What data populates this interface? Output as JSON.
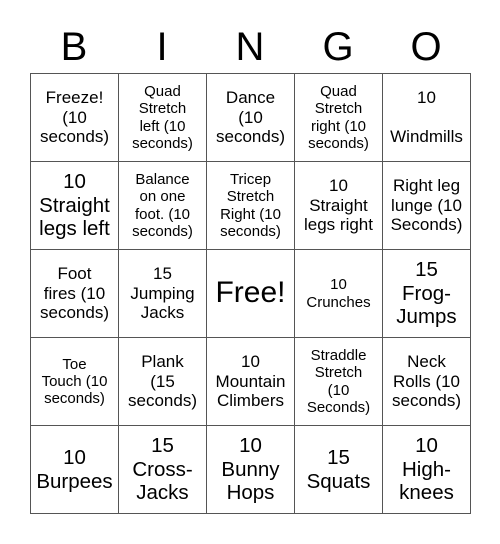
{
  "header": [
    "B",
    "I",
    "N",
    "G",
    "O"
  ],
  "cells": [
    "Freeze!\n(10\nseconds)",
    "Quad\nStretch\nleft (10\nseconds)",
    "Dance\n(10\nseconds)",
    "Quad\nStretch\nright (10\nseconds)",
    "10\n\nWindmills",
    "10\nStraight\nlegs left",
    "Balance\non one\nfoot. (10\nseconds)",
    "Tricep\nStretch\nRight (10\nseconds)",
    "10\nStraight\nlegs right",
    "Right leg\nlunge (10\nSeconds)",
    "Foot\nfires (10\nseconds)",
    "15\nJumping\nJacks",
    "Free!",
    "10\nCrunches",
    "15\nFrog-\nJumps",
    "Toe\nTouch (10\nseconds)",
    "Plank\n(15\nseconds)",
    "10\nMountain\nClimbers",
    "Straddle\nStretch\n(10\nSeconds)",
    "Neck\nRolls (10\nseconds)",
    "10\nBurpees",
    "15\nCross-\nJacks",
    "10\nBunny\nHops",
    "15\nSquats",
    "10\nHigh-\nknees"
  ]
}
